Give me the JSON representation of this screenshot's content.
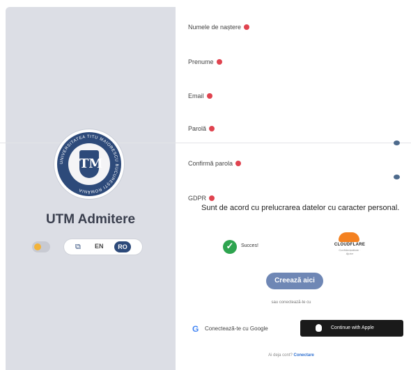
{
  "brand": {
    "app_title": "UTM Admitere",
    "logo_ring_text": "UNIVERSITATEA TITU MAIORESCU BUCUREȘTI ROMÂNIA",
    "logo_emblem": "TM"
  },
  "settings": {
    "lang_en": "EN",
    "lang_ro": "RO",
    "globe_icon": "translate-icon"
  },
  "form": {
    "fields": [
      {
        "label": "Numele de naștere"
      },
      {
        "label": "Prenume"
      },
      {
        "label": "Email"
      },
      {
        "label": "Parolă"
      },
      {
        "label": "Confirmă parola"
      },
      {
        "label": "GDPR"
      }
    ],
    "gdpr_text": "Sunt de acord cu prelucrarea datelor cu caracter personal.",
    "captcha_status": "Succes!",
    "cloudflare_word": "CLOUDFLARE",
    "cloudflare_small": "Confidențialitate · Ajutor",
    "create_button": "Creează aici",
    "or_text": "sau conectează-te cu",
    "google_button": "Conectează-te cu Google",
    "apple_button": "Continue with Apple",
    "has_account": "Ai deja cont?",
    "login_link": "Conectare"
  },
  "colors": {
    "brand_blue": "#2d4a7a",
    "required_dot": "#e0434f",
    "success_green": "#2ea44f",
    "create_button": "#6f87b5"
  }
}
